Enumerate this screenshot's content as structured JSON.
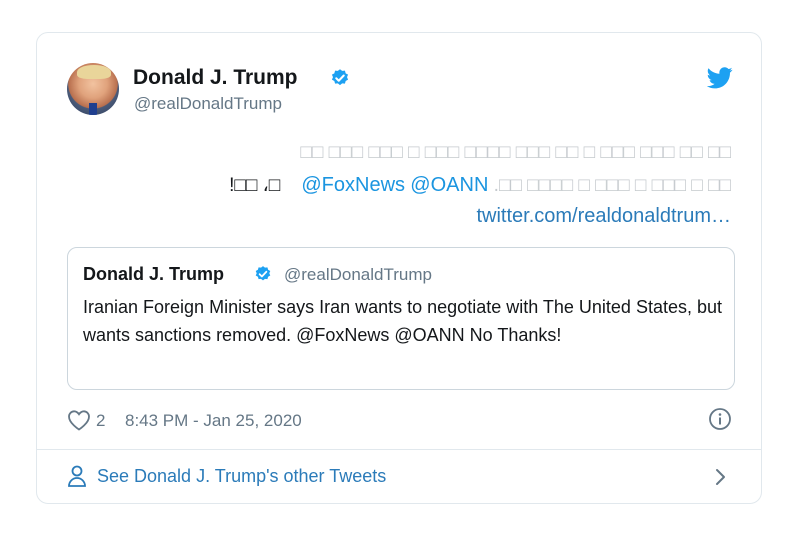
{
  "tweet": {
    "author_name": "Donald J. Trump",
    "author_handle": "@realDonaldTrump",
    "verified_icon": "verified-badge-icon",
    "logo_icon": "twitter-bird-icon",
    "body_line1": "□□ □□□ □□□ □ □□□ □□□□ □□□ □□ □ □□□ □□□ □□ □□",
    "body_line2_prefix": "!□□ ،□",
    "body_mention1": "@FoxNews",
    "body_mention2": "@OANN",
    "body_line2_suffix": ".□□ □□□□ □ □□□ □ □□□ □ □□",
    "link": "twitter.com/realdonaldtrum…",
    "quoted": {
      "author_name": "Donald J. Trump",
      "author_handle": "@realDonaldTrump",
      "text": "Iranian Foreign Minister says Iran wants to negotiate with The United States, but wants sanctions removed. @FoxNews  @OANN No Thanks!"
    },
    "like_count": "2",
    "timestamp": "8:43 PM - Jan 25, 2020",
    "footer_text": "See Donald J. Trump's other Tweets"
  },
  "colors": {
    "accent": "#1da1f2",
    "link": "#2b7bb9",
    "muted": "#657786",
    "border": "#e1e8ed"
  }
}
